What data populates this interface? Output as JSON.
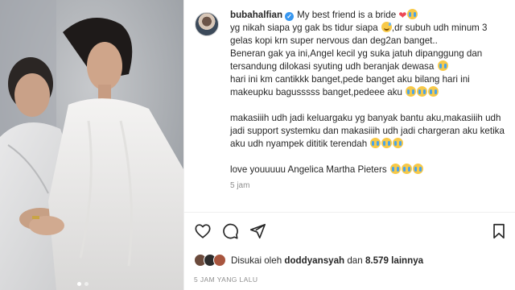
{
  "post": {
    "username": "bubahalfian",
    "verified_icon": "verified-badge-icon",
    "caption_lines": [
      {
        "text": "My best friend is a bride",
        "emoji": [
          "heart",
          "crying"
        ]
      },
      {
        "text": "yg nikah siapa yg gak bs tidur siapa",
        "emoji": [
          "sweat-smile"
        ]
      },
      {
        "text": ",dr subuh udh minum 3 gelas kopi krn super nervous dan deg2an banget.."
      },
      {
        "text": "Beneran gak ya ini,Angel kecil yg suka jatuh dipanggung dan tersandung dilokasi syuting udh beranjak dewasa",
        "emoji": [
          "crying"
        ]
      },
      {
        "text": "hari ini km cantikkk banget,pede banget aku bilang hari ini makeupku bagusssss banget,pedeee aku",
        "emoji": [
          "crying",
          "crying",
          "crying"
        ]
      },
      {
        "text": "makasiiih udh jadi keluargaku yg banyak bantu aku,makasiiih udh jadi support systemku dan makasiiih udh jadi chargeran aku ketika aku udh nyampek dititik terendah",
        "emoji": [
          "crying",
          "crying",
          "crying"
        ]
      },
      {
        "text": "love youuuuu Angelica Martha Pieters",
        "emoji": [
          "crying",
          "crying",
          "crying"
        ]
      }
    ],
    "time_ago": "5 jam",
    "likes": {
      "prefix": "Disukai oleh",
      "user": "doddyansyah",
      "conjunction": "dan",
      "others": "8.579 lainnya"
    },
    "posted_label": "5 JAM YANG LALU"
  },
  "actions": {
    "like_icon": "heart-outline-icon",
    "comment_icon": "comment-icon",
    "share_icon": "send-icon",
    "save_icon": "bookmark-icon"
  },
  "colors": {
    "text": "#262626",
    "muted": "#8e8e8e",
    "heart": "#ed4956",
    "verified": "#3897f0"
  }
}
